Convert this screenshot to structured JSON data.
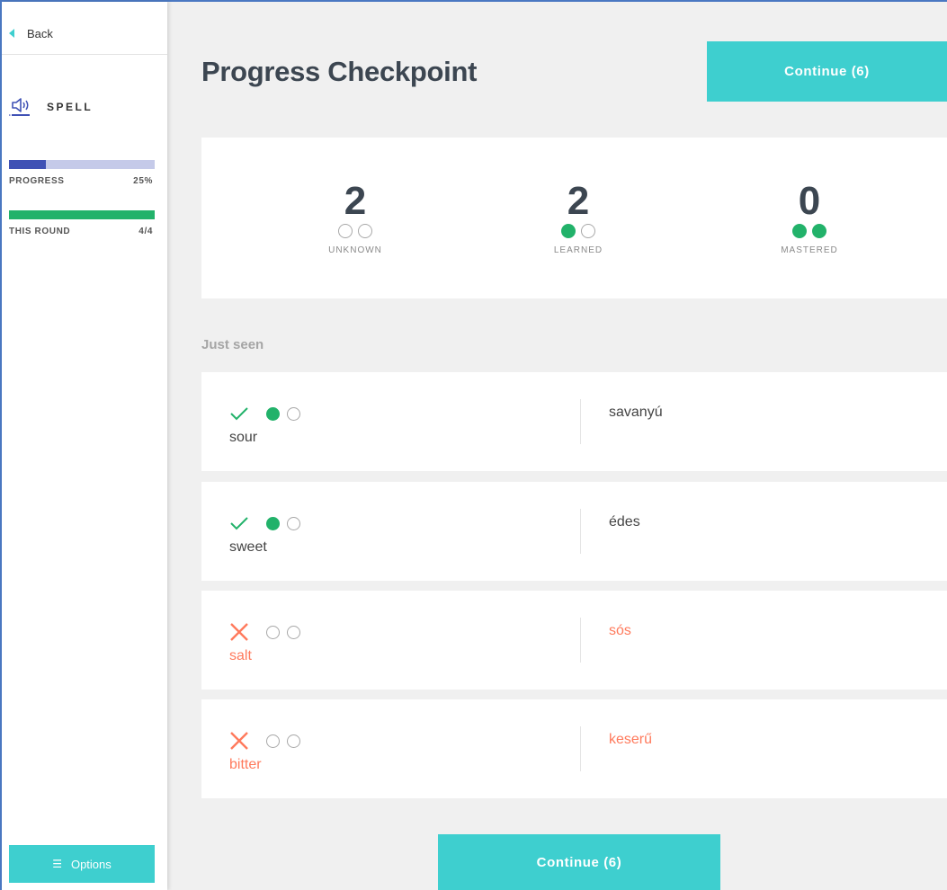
{
  "sidebar": {
    "back_label": "Back",
    "mode_label": "SPELL",
    "progress": {
      "label": "PROGRESS",
      "value_text": "25%",
      "fraction": 0.25,
      "fill_color": "#3f51b5",
      "track_color": "#c5cae9"
    },
    "round": {
      "label": "THIS ROUND",
      "value_text": "4/4",
      "fraction": 1.0,
      "fill_color": "#22b26a"
    },
    "options_label": "Options"
  },
  "header": {
    "title": "Progress Checkpoint",
    "continue_label": "Continue (6)"
  },
  "stats": [
    {
      "value": "2",
      "caption": "UNKNOWN",
      "filled": 0
    },
    {
      "value": "2",
      "caption": "LEARNED",
      "filled": 1
    },
    {
      "value": "0",
      "caption": "MASTERED",
      "filled": 2
    }
  ],
  "just_seen_label": "Just seen",
  "items": [
    {
      "word": "sour",
      "definition": "savanyú",
      "correct": true,
      "filled": 1
    },
    {
      "word": "sweet",
      "definition": "édes",
      "correct": true,
      "filled": 1
    },
    {
      "word": "salt",
      "definition": "sós",
      "correct": false,
      "filled": 0
    },
    {
      "word": "bitter",
      "definition": "keserű",
      "correct": false,
      "filled": 0
    }
  ],
  "footer": {
    "continue_label": "Continue (6)"
  },
  "colors": {
    "accent": "#3ecfcf",
    "correct": "#22b26a",
    "wrong": "#ff7a5c"
  }
}
